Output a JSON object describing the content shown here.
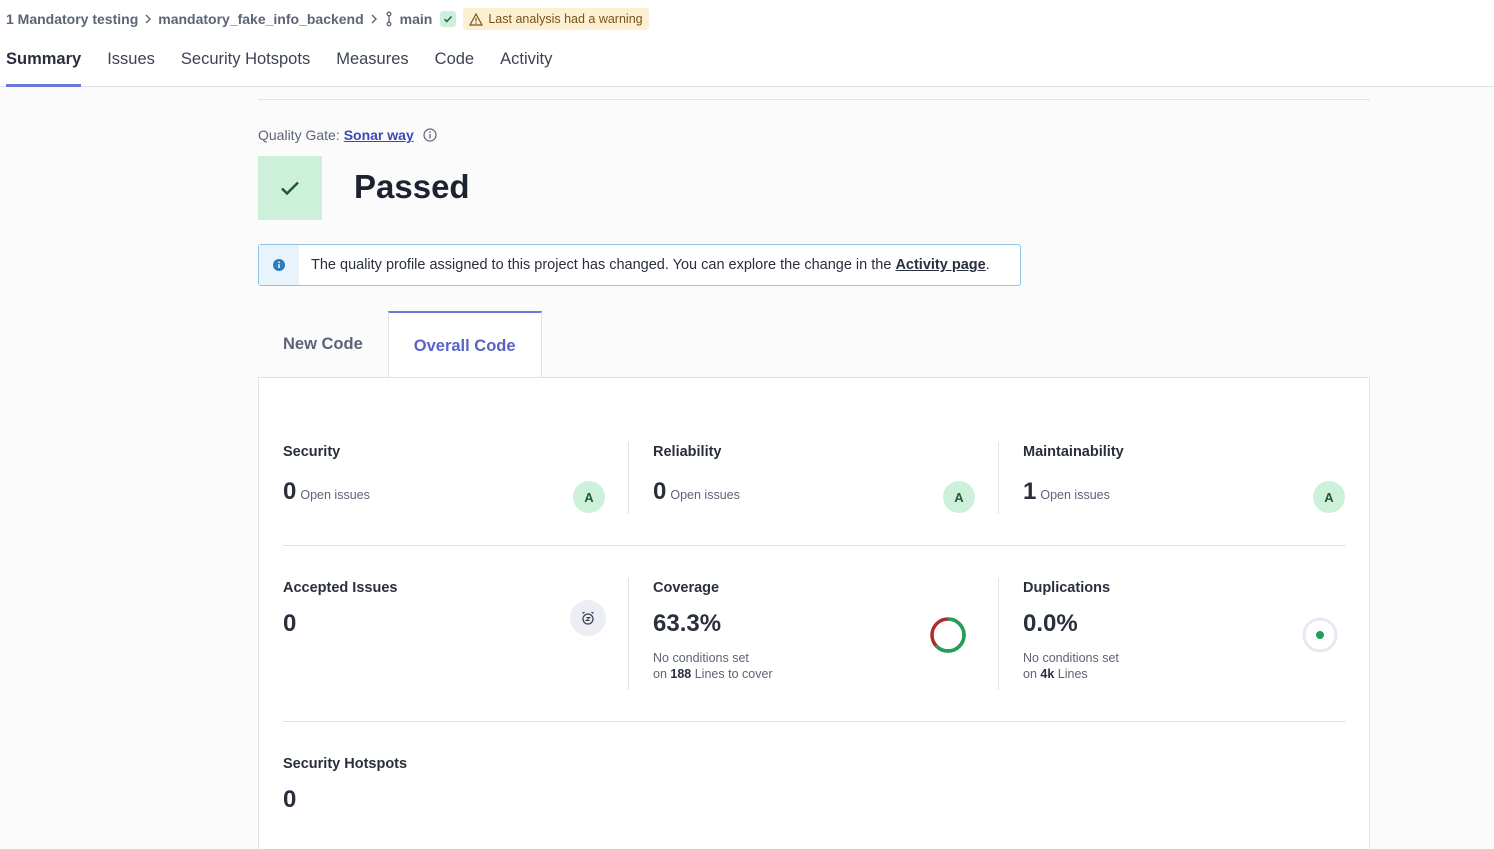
{
  "breadcrumb": {
    "project": "1 Mandatory testing",
    "repo": "mandatory_fake_info_backend",
    "branch": "main",
    "warning": "Last analysis had a warning"
  },
  "nav": [
    "Summary",
    "Issues",
    "Security Hotspots",
    "Measures",
    "Code",
    "Activity"
  ],
  "quality_gate": {
    "label": "Quality Gate:",
    "name": "Sonar way",
    "status": "Passed"
  },
  "alert": {
    "text": "The quality profile assigned to this project has changed. You can explore the change in the",
    "link": "Activity page",
    "tail": "."
  },
  "tabs": [
    "New Code",
    "Overall Code"
  ],
  "metrics": {
    "security": {
      "title": "Security",
      "value": "0",
      "label": "Open issues",
      "grade": "A"
    },
    "reliability": {
      "title": "Reliability",
      "value": "0",
      "label": "Open issues",
      "grade": "A"
    },
    "maintainability": {
      "title": "Maintainability",
      "value": "1",
      "label": "Open issues",
      "grade": "A"
    },
    "accepted": {
      "title": "Accepted Issues",
      "value": "0"
    },
    "coverage": {
      "title": "Coverage",
      "value": "63.3%",
      "line1": "No conditions set",
      "line2_pre": "on",
      "line2_num": "188",
      "line2_post": "Lines to cover",
      "percent": 63.3
    },
    "duplications": {
      "title": "Duplications",
      "value": "0.0%",
      "line1": "No conditions set",
      "line2_pre": "on",
      "line2_num": "4k",
      "line2_post": "Lines"
    },
    "hotspots": {
      "title": "Security Hotspots",
      "value": "0"
    }
  },
  "colors": {
    "accent": "#6d78d6",
    "success": "#1ea05a",
    "danger": "#b32b2b",
    "grade_bg": "#cdf0da"
  }
}
